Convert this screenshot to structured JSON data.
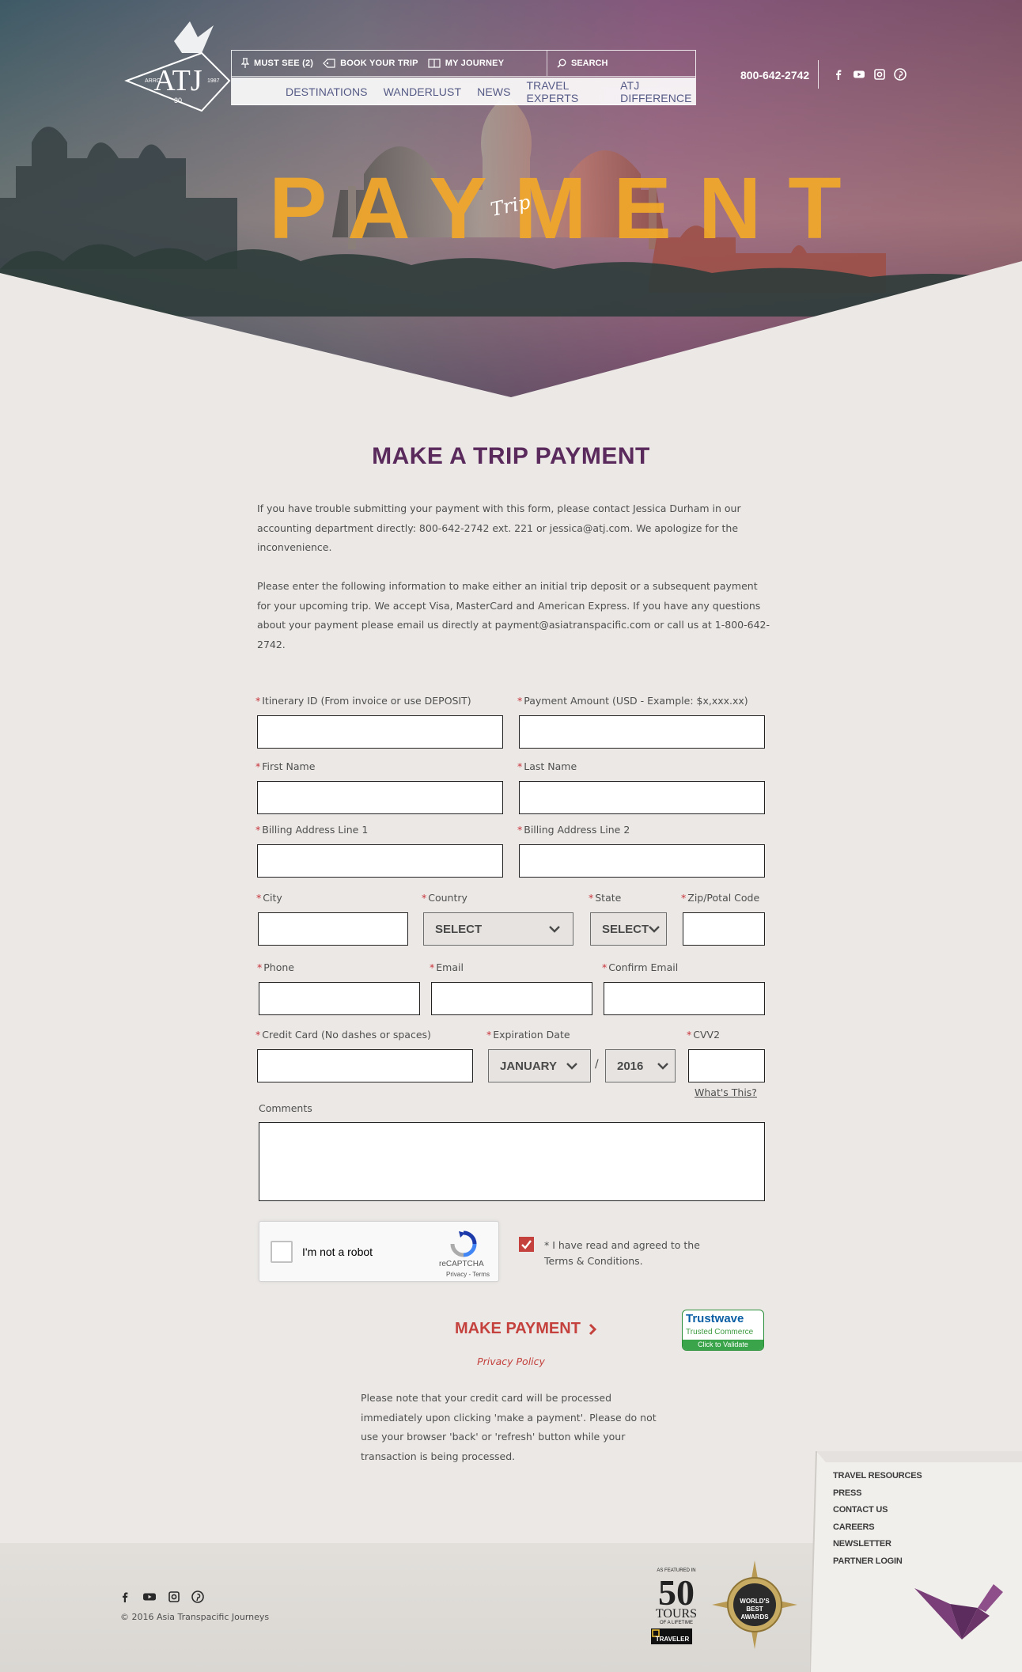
{
  "header": {
    "logo": {
      "text": "ATJ",
      "left": "ARRO",
      "right": "1987",
      "badge": "30"
    },
    "nav_top": [
      {
        "label": "MUST SEE (2)",
        "icon": "pin-icon"
      },
      {
        "label": "BOOK YOUR TRIP",
        "icon": "tag-icon"
      },
      {
        "label": "MY JOURNEY",
        "icon": "book-icon"
      }
    ],
    "search_label": "SEARCH",
    "nav_main": [
      "DESTINATIONS",
      "WANDERLUST",
      "NEWS",
      "TRAVEL EXPERTS",
      "ATJ DIFFERENCE"
    ],
    "phone": "800-642-2742",
    "socials": [
      "facebook-icon",
      "youtube-icon",
      "instagram-icon",
      "pinterest-icon"
    ]
  },
  "hero": {
    "title": "PAYMENT",
    "subtitle": "Trip"
  },
  "main": {
    "heading": "MAKE A TRIP PAYMENT",
    "intro_1": "If you have trouble submitting your payment with this form, please contact Jessica Durham in our accounting department directly: 800-642-2742 ext. 221 or jessica@atj.com. We apologize for the inconvenience.",
    "intro_2": "Please enter the following information to make either an initial trip deposit or a subsequent payment for your upcoming trip. We accept Visa, MasterCard and American Express. If you have any questions about your payment please email us directly at payment@asiatranspacific.com or call us at 1-800-642-2742."
  },
  "form": {
    "required_mark": "*",
    "itinerary_label": "Itinerary ID (From invoice or use DEPOSIT)",
    "amount_label": "Payment Amount (USD - Example: $x,xxx.xx)",
    "first_name_label": "First Name",
    "last_name_label": "Last Name",
    "address1_label": "Billing Address Line 1",
    "address2_label": "Billing Address Line 2",
    "city_label": "City",
    "country_label": "Country",
    "country_value": "SELECT",
    "state_label": "State",
    "state_value": "SELECT",
    "zip_label": "Zip/Potal Code",
    "phone_label": "Phone",
    "email_label": "Email",
    "confirm_email_label": "Confirm Email",
    "card_label": "Credit Card (No dashes or spaces)",
    "expiration_label": "Expiration Date",
    "exp_month": "JANUARY",
    "exp_separator": "/",
    "exp_year": "2016",
    "cvv_label": "CVV2",
    "cvv_help": "What's This?",
    "comments_label": "Comments",
    "captcha_text": "I'm not a robot",
    "captcha_brand": "reCAPTCHA",
    "captcha_links": "Privacy - Terms",
    "agree_text": "* I have read and agreed to the Terms & Conditions.",
    "agree_checked": true,
    "submit_label": "MAKE PAYMENT",
    "trustwave_title": "Trustwave",
    "trustwave_sub": "Trusted Commerce",
    "trustwave_cta": "Click to Validate",
    "privacy_link": "Privacy Policy",
    "note": "Please note that your credit card will be processed immediately upon clicking 'make a payment'.   Please do not use your browser 'back' or 'refresh' button while your transaction is being processed."
  },
  "footer": {
    "copyright": "© 2016 Asia Transpacific Journeys",
    "badge_small": "AS FEATURED IN",
    "badge_number": "50",
    "badge_tours": "TOURS",
    "badge_lifetime": "OF A LIFETIME",
    "badge_brand": "TRAVELER",
    "award_text": "WORLD'S BEST AWARDS",
    "links": [
      "TRAVEL RESOURCES",
      "PRESS",
      "CONTACT US",
      "CAREERS",
      "NEWSLETTER",
      "PARTNER LOGIN"
    ]
  },
  "colors": {
    "accent_purple": "#5a2a5c",
    "accent_red": "#c4413d",
    "hero_title": "#f0a72c",
    "page_bg": "#ebe8e5"
  }
}
